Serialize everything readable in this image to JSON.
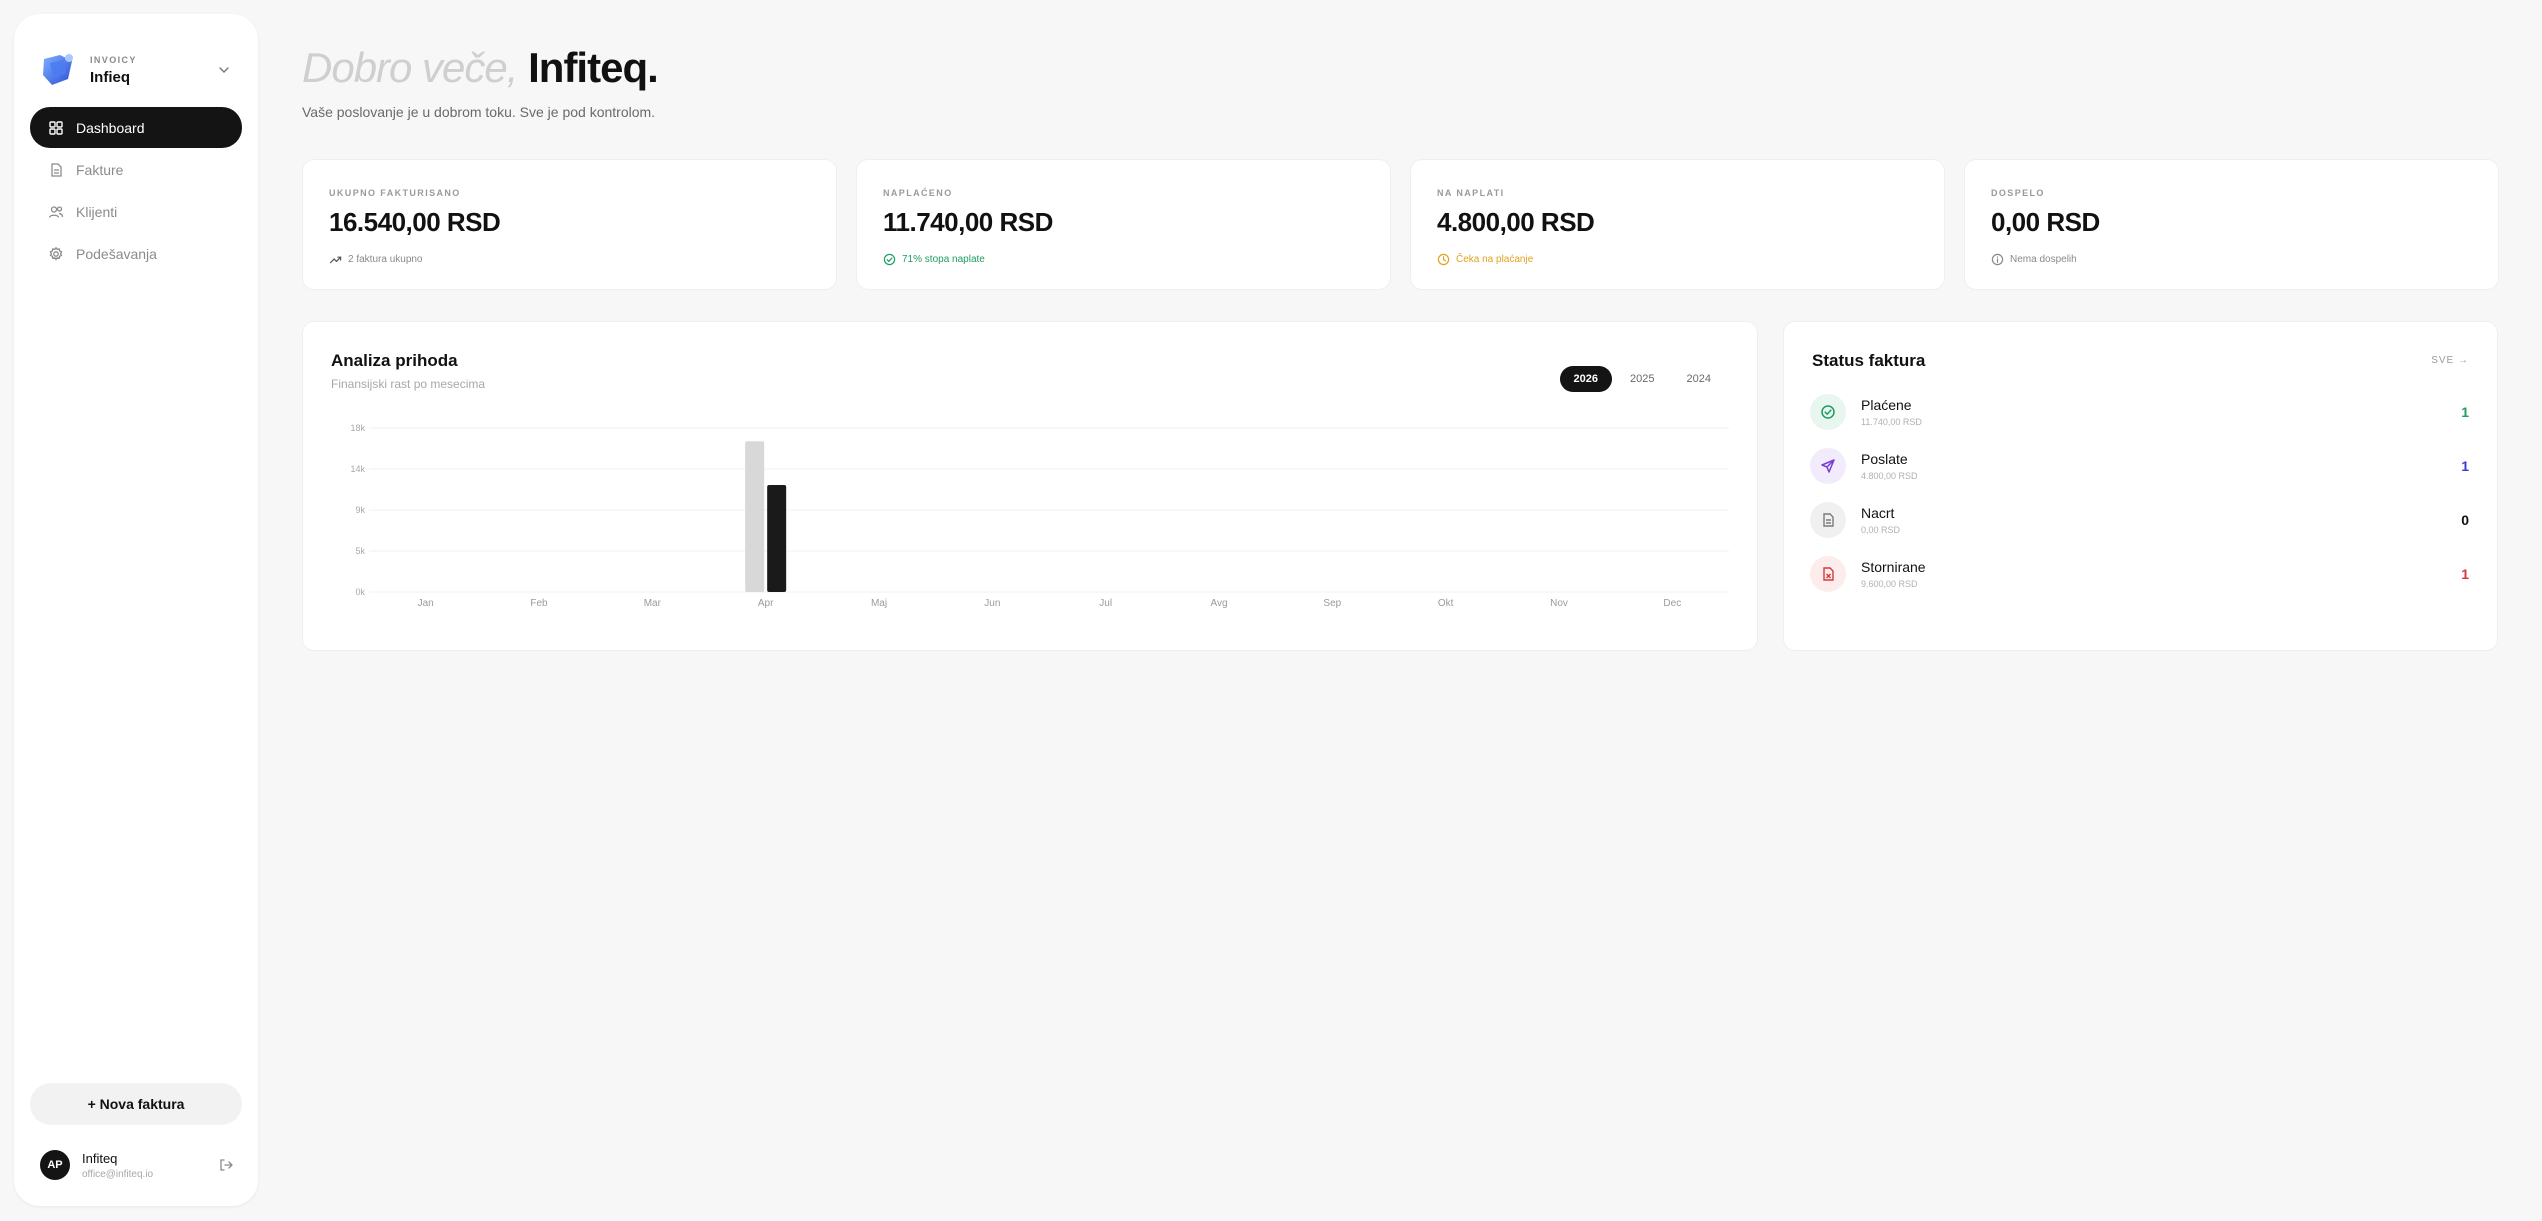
{
  "brand": {
    "kicker": "INVOICY",
    "name": "Infieq"
  },
  "nav": [
    {
      "label": "Dashboard",
      "icon": "dashboard-icon",
      "active": true
    },
    {
      "label": "Fakture",
      "icon": "document-icon"
    },
    {
      "label": "Klijenti",
      "icon": "users-icon"
    },
    {
      "label": "Podešavanja",
      "icon": "gear-icon"
    }
  ],
  "new_invoice_label": "+ Nova faktura",
  "user": {
    "initials": "AP",
    "name": "Infiteq",
    "email": "office@infiteq.io"
  },
  "header": {
    "greeting_light": "Dobro veče,",
    "greeting_strong": "Infiteq.",
    "subtitle": "Vaše poslovanje je u dobrom toku. Sve je pod kontrolom."
  },
  "kpis": [
    {
      "label": "UKUPNO FAKTURISANO",
      "value": "16.540,00 RSD",
      "note": "2 faktura ukupno",
      "note_color": "#8a8a8a",
      "icon": "trend-up-icon"
    },
    {
      "label": "NAPLAĆENO",
      "value": "11.740,00 RSD",
      "note": "71% stopa naplate",
      "note_color": "#1f9d63",
      "icon": "check-circle-icon"
    },
    {
      "label": "NA NAPLATI",
      "value": "4.800,00 RSD",
      "note": "Čeka na plaćanje",
      "note_color": "#e0a21f",
      "icon": "clock-icon"
    },
    {
      "label": "DOSPELO",
      "value": "0,00 RSD",
      "note": "Nema dospelih",
      "note_color": "#8a8a8a",
      "icon": "info-circle-icon"
    }
  ],
  "revenue": {
    "title": "Analiza prihoda",
    "subtitle": "Finansijski rast po mesecima",
    "years": [
      "2026",
      "2025",
      "2024"
    ],
    "active_year": "2026"
  },
  "chart_data": {
    "type": "bar",
    "categories": [
      "Jan",
      "Feb",
      "Mar",
      "Apr",
      "Maj",
      "Jun",
      "Jul",
      "Avg",
      "Sep",
      "Okt",
      "Nov",
      "Dec"
    ],
    "series": [
      {
        "color": "#d8d8d8",
        "values": [
          0,
          0,
          0,
          16540,
          0,
          0,
          0,
          0,
          0,
          0,
          0,
          0
        ]
      },
      {
        "color": "#1a1a1a",
        "values": [
          0,
          0,
          0,
          11740,
          0,
          0,
          0,
          0,
          0,
          0,
          0,
          0
        ]
      }
    ],
    "ytick_labels": [
      "0k",
      "5k",
      "9k",
      "14k",
      "18k"
    ],
    "ylim": [
      0,
      18000
    ],
    "grid": true
  },
  "status": {
    "title": "Status faktura",
    "all_label": "SVE →",
    "items": [
      {
        "name": "Plaćene",
        "amount": "11.740,00 RSD",
        "count": "1",
        "color": "#1f9d63",
        "bg": "#e8f6ef",
        "icon": "check-circle-icon"
      },
      {
        "name": "Poslate",
        "amount": "4.800,00 RSD",
        "count": "1",
        "color": "#7a3fd1",
        "bg": "#f1ebfb",
        "icon": "send-icon"
      },
      {
        "name": "Nacrt",
        "amount": "0,00 RSD",
        "count": "0",
        "color": "#7a7a7a",
        "bg": "#f0f0f0",
        "icon": "document-icon"
      },
      {
        "name": "Stornirane",
        "amount": "9.600,00 RSD",
        "count": "1",
        "color": "#d33a3a",
        "bg": "#fdecec",
        "icon": "file-x-icon"
      }
    ]
  }
}
